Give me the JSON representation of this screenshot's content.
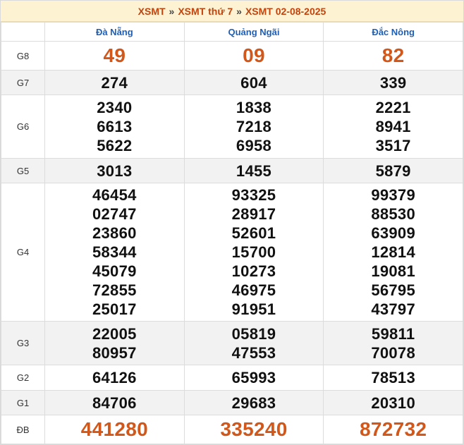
{
  "breadcrumb": {
    "home": "XSMT",
    "day": "XSMT thứ 7",
    "date": "XSMT 02-08-2025",
    "separator": "»"
  },
  "columns": [
    "Đà Nẵng",
    "Quảng Ngãi",
    "Đắc Nông"
  ],
  "prizes": [
    {
      "label": "G8",
      "values": [
        [
          "49"
        ],
        [
          "09"
        ],
        [
          "82"
        ]
      ]
    },
    {
      "label": "G7",
      "values": [
        [
          "274"
        ],
        [
          "604"
        ],
        [
          "339"
        ]
      ]
    },
    {
      "label": "G6",
      "values": [
        [
          "2340",
          "6613",
          "5622"
        ],
        [
          "1838",
          "7218",
          "6958"
        ],
        [
          "2221",
          "8941",
          "3517"
        ]
      ]
    },
    {
      "label": "G5",
      "values": [
        [
          "3013"
        ],
        [
          "1455"
        ],
        [
          "5879"
        ]
      ]
    },
    {
      "label": "G4",
      "values": [
        [
          "46454",
          "02747",
          "23860",
          "58344",
          "45079",
          "72855",
          "25017"
        ],
        [
          "93325",
          "28917",
          "52601",
          "15700",
          "10273",
          "46975",
          "91951"
        ],
        [
          "99379",
          "88530",
          "63909",
          "12814",
          "19081",
          "56795",
          "43797"
        ]
      ]
    },
    {
      "label": "G3",
      "values": [
        [
          "22005",
          "80957"
        ],
        [
          "05819",
          "47553"
        ],
        [
          "59811",
          "70078"
        ]
      ]
    },
    {
      "label": "G2",
      "values": [
        [
          "64126"
        ],
        [
          "65993"
        ],
        [
          "78513"
        ]
      ]
    },
    {
      "label": "G1",
      "values": [
        [
          "84706"
        ],
        [
          "29683"
        ],
        [
          "20310"
        ]
      ]
    },
    {
      "label": "ĐB",
      "values": [
        [
          "441280"
        ],
        [
          "335240"
        ],
        [
          "872732"
        ]
      ]
    }
  ],
  "colors": {
    "accent": "#d2571a",
    "header_text": "#1d5fb8",
    "title_bg": "#fdf3d3"
  }
}
